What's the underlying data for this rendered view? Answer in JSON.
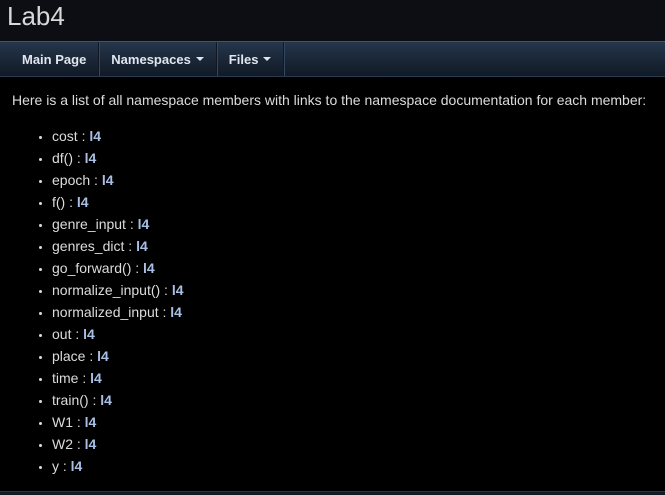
{
  "header": {
    "project_name": "Lab4"
  },
  "navbar": {
    "items": [
      {
        "label": "Main Page",
        "has_caret": false
      },
      {
        "label": "Namespaces",
        "has_caret": true
      },
      {
        "label": "Files",
        "has_caret": true
      }
    ]
  },
  "main": {
    "intro": "Here is a list of all namespace members with links to the namespace documentation for each member:",
    "members": [
      {
        "name": "cost",
        "ns": "l4"
      },
      {
        "name": "df()",
        "ns": "l4"
      },
      {
        "name": "epoch",
        "ns": "l4"
      },
      {
        "name": "f()",
        "ns": "l4"
      },
      {
        "name": "genre_input",
        "ns": "l4"
      },
      {
        "name": "genres_dict",
        "ns": "l4"
      },
      {
        "name": "go_forward()",
        "ns": "l4"
      },
      {
        "name": "normalize_input()",
        "ns": "l4"
      },
      {
        "name": "normalized_input",
        "ns": "l4"
      },
      {
        "name": "out",
        "ns": "l4"
      },
      {
        "name": "place",
        "ns": "l4"
      },
      {
        "name": "time",
        "ns": "l4"
      },
      {
        "name": "train()",
        "ns": "l4"
      },
      {
        "name": "W1",
        "ns": "l4"
      },
      {
        "name": "W2",
        "ns": "l4"
      },
      {
        "name": "y",
        "ns": "l4"
      }
    ]
  },
  "colors": {
    "background": "#000000",
    "link": "#a9c0e4",
    "text": "#dcdcdc",
    "navbar": "#1a2636"
  }
}
